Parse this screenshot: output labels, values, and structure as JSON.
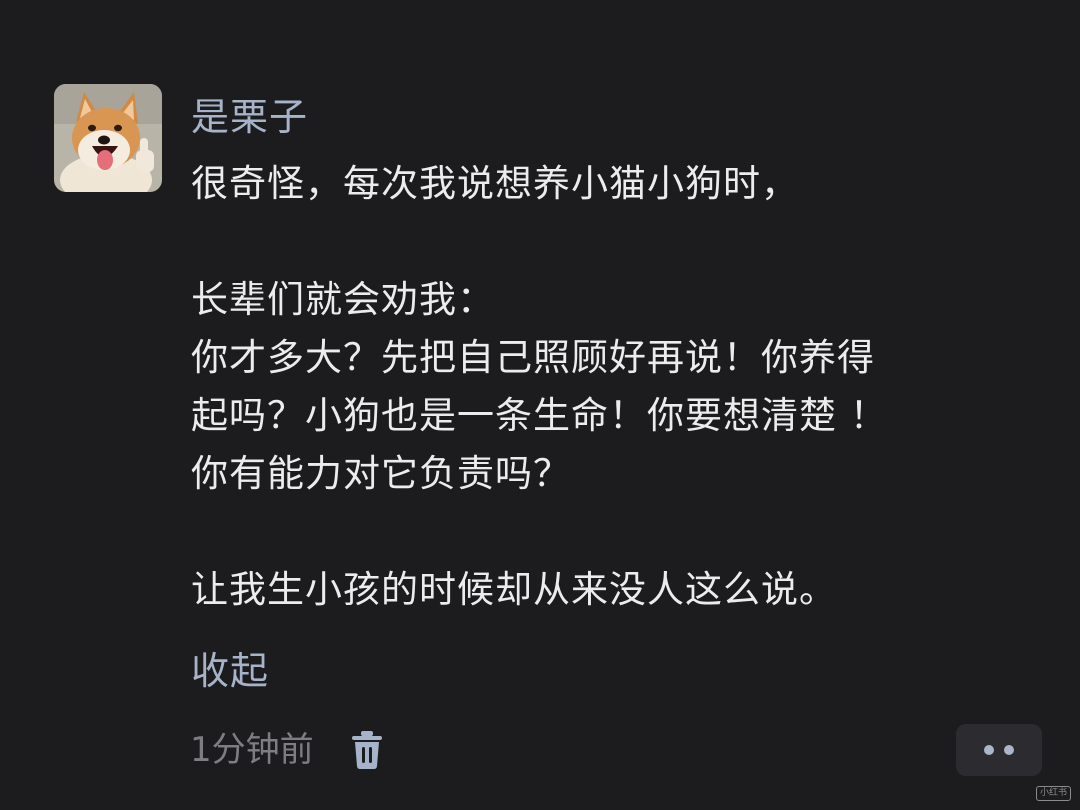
{
  "comment": {
    "username": "是栗子",
    "avatar": "shiba-dog-avatar",
    "lines": [
      "很奇怪，每次我说想养小猫小狗时，",
      "",
      "长辈们就会劝我：",
      "你才多大？先把自己照顾好再说！你养得",
      "起吗？小狗也是一条生命！你要想清楚 ！",
      "你有能力对它负责吗？",
      "",
      "让我生小孩的时候却从来没人这么说。"
    ],
    "collapse_label": "收起",
    "timestamp": "1分钟前",
    "delete_icon": "trash-icon",
    "more_icon": "more-dots-icon"
  },
  "watermark": "小红书",
  "colors": {
    "background": "#1c1c1e",
    "username": "#a7b3c9",
    "text": "#ececec",
    "muted": "#7d7d83",
    "button_bg": "#2c2c30"
  }
}
